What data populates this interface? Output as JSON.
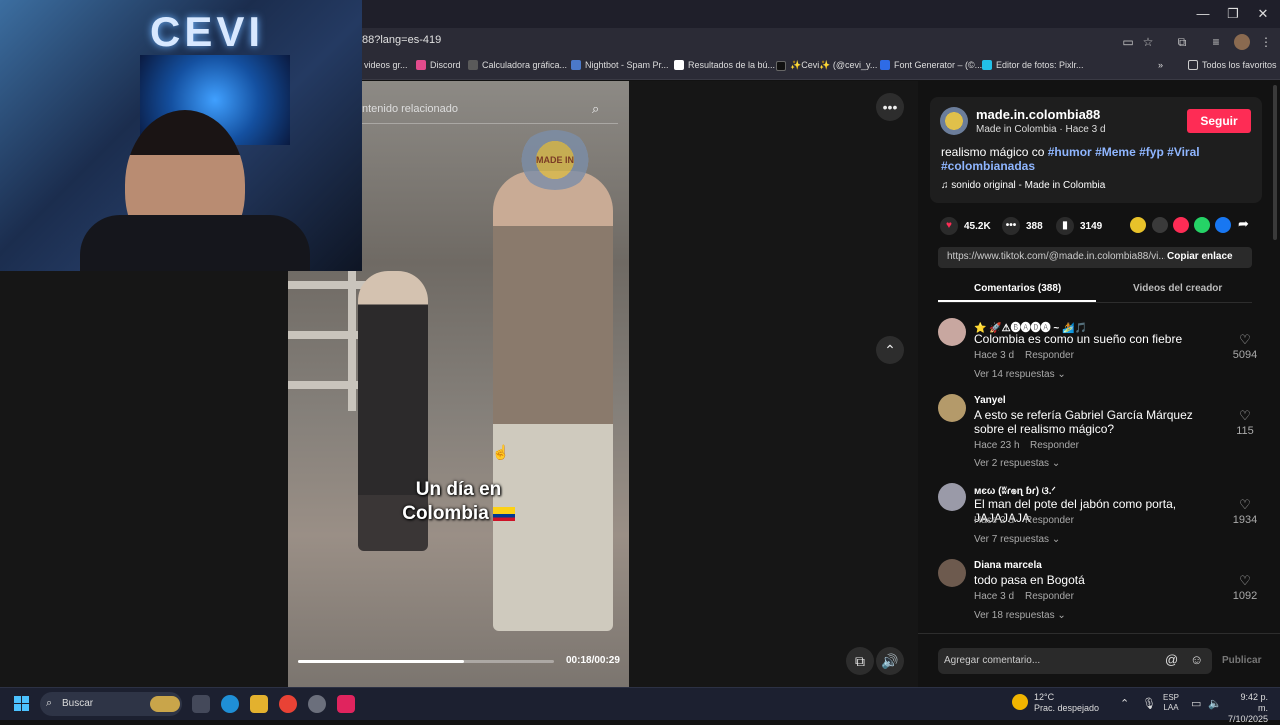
{
  "browser": {
    "url": "88?lang=es-419",
    "bookmarks": [
      {
        "label": "videos gr...",
        "color": "#777"
      },
      {
        "label": "Discord",
        "color": "#e24b8d"
      },
      {
        "label": "Calculadora gráfica...",
        "color": "#5a5a5a"
      },
      {
        "label": "Nightbot - Spam Pr...",
        "color": "#4b79c9"
      },
      {
        "label": "Resultados de la bú...",
        "color": "#ffffff"
      },
      {
        "label": "✨Cevi✨ (@cevi_y...",
        "color": "#111111"
      },
      {
        "label": "Font Generator – (©...",
        "color": "#2e6be6"
      },
      {
        "label": "Editor de fotos: Pixlr...",
        "color": "#22c0e8"
      }
    ],
    "all_favorites": "Todos los favoritos"
  },
  "video": {
    "search_placeholder": "ntenido relacionado",
    "caption_line1": "Un día en",
    "caption_line2": "Colombia",
    "watermark": "MADE IN",
    "time": "00:18/00:29",
    "progress": 0.65
  },
  "post": {
    "author": "made.in.colombia88",
    "author_sub": "Made in Colombia · Hace 3 d",
    "follow_label": "Seguir",
    "desc_prefix": "realismo mágico co ",
    "tags": [
      "#humor",
      "#Meme",
      "#fyp",
      "#Viral",
      "#colombianadas"
    ],
    "sound": "sonido original - Made in Colombia",
    "likes": "45.2K",
    "comments": "388",
    "saves": "3149",
    "link": "https://www.tiktok.com/@made.in.colombia88/vi...",
    "copy_label": "Copiar enlace",
    "tab_comments": "Comentarios (388)",
    "tab_videos": "Videos del creador"
  },
  "comments": [
    {
      "name": "⭐ 🚀⚠🅑🅐🅓🅐 ~ 🏄🎵",
      "text": "Colombia es como un sueño con fiebre",
      "time": "Hace 3 d",
      "reply": "Responder",
      "more": "Ver 14 respuestas ⌄",
      "likes": "5094",
      "avatar": "#c8a7a0"
    },
    {
      "name": "Yanyel",
      "text": "A esto se refería Gabriel García Márquez sobre el realismo mágico?",
      "time": "Hace 23 h",
      "reply": "Responder",
      "more": "Ver 2 respuestas ⌄",
      "likes": "115",
      "avatar": "#b49a6a"
    },
    {
      "name": "мєω (ʬɾ๏ɳ ɓɾ) ଓ.ᐟ",
      "text": "El man del pote del jabón como porta, JAJAJAJA",
      "time": "Hace 2 d",
      "reply": "Responder",
      "more": "Ver 7 respuestas ⌄",
      "likes": "1934",
      "avatar": "#9a9aa8"
    },
    {
      "name": "Diana marcela",
      "text": "todo pasa en Bogotá",
      "time": "Hace 3 d",
      "reply": "Responder",
      "more": "Ver 18 respuestas ⌄",
      "likes": "1092",
      "avatar": "#6d5a4e"
    }
  ],
  "composer": {
    "placeholder": "Agregar comentario...",
    "publish": "Publicar"
  },
  "taskbar": {
    "search": "Buscar",
    "temp": "12°C",
    "weather": "Prac. despejado",
    "lang1": "ESP",
    "lang2": "LAA",
    "time": "9:42 p. m.",
    "date": "7/10/2025"
  },
  "colors": {
    "accent": "#fe2c55",
    "tag": "#8fb6ff"
  }
}
